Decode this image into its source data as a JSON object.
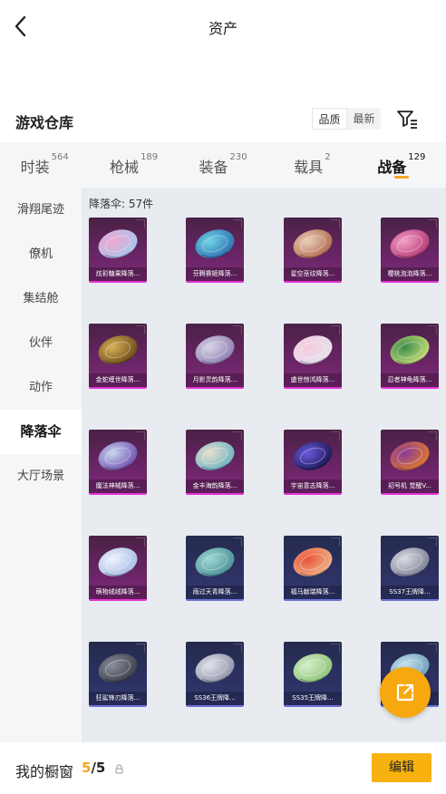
{
  "header": {
    "title": "资产"
  },
  "section": {
    "title": "游戏仓库",
    "sort": [
      "品质",
      "最新"
    ]
  },
  "tabs": [
    {
      "label": "时装",
      "count": "564"
    },
    {
      "label": "枪械",
      "count": "189"
    },
    {
      "label": "装备",
      "count": "230"
    },
    {
      "label": "载具",
      "count": "2"
    },
    {
      "label": "战备",
      "count": "129",
      "active": true
    }
  ],
  "sidebar": {
    "items": [
      "滑翔尾迹",
      "僚机",
      "集结舱",
      "伙伴",
      "动作",
      "降落伞",
      "大厅场景"
    ],
    "active_index": 5
  },
  "grid": {
    "subtitle": "降落伞: 57件",
    "items": [
      {
        "name": "炫彩糖果降落...",
        "rarity": "purple",
        "colors": [
          "#f2a6cf",
          "#a7c7f0"
        ]
      },
      {
        "name": "芬腾赛姬降落...",
        "rarity": "purple",
        "colors": [
          "#6fd3e6",
          "#2d6fb0"
        ]
      },
      {
        "name": "星空巫纹降落...",
        "rarity": "purple",
        "colors": [
          "#e9d0b8",
          "#b26a4e"
        ]
      },
      {
        "name": "樱桃泡泡降落...",
        "rarity": "purple",
        "colors": [
          "#f6a0c5",
          "#b23a76"
        ]
      },
      {
        "name": "金蛇缠世降落...",
        "rarity": "purple",
        "colors": [
          "#d8b055",
          "#6a4a1a"
        ]
      },
      {
        "name": "月影灵韵降落...",
        "rarity": "purple",
        "colors": [
          "#d9d2e6",
          "#8d7fb3"
        ]
      },
      {
        "name": "盛世惊鸿降落...",
        "rarity": "purple",
        "colors": [
          "#f5c9dc",
          "#e6e2ef"
        ]
      },
      {
        "name": "忍者神龟降落...",
        "rarity": "purple",
        "colors": [
          "#3d8a4a",
          "#c8e07a"
        ]
      },
      {
        "name": "魔法神械降落...",
        "rarity": "purple",
        "colors": [
          "#c8d6f0",
          "#6f4fae"
        ]
      },
      {
        "name": "金丰海韵降落...",
        "rarity": "purple",
        "colors": [
          "#e8e0cc",
          "#6bb3c4"
        ]
      },
      {
        "name": "宇宙意志降落...",
        "rarity": "purple",
        "colors": [
          "#6a5ae0",
          "#1a1550"
        ]
      },
      {
        "name": "初号机 觉醒V...",
        "rarity": "purple",
        "colors": [
          "#8a3a9a",
          "#e07a2a"
        ]
      },
      {
        "name": "萌物绒绒降落...",
        "rarity": "purple",
        "colors": [
          "#eef2fb",
          "#a9bde6"
        ]
      },
      {
        "name": "雨过天青降落...",
        "rarity": "blue",
        "colors": [
          "#9fd8d2",
          "#4b8f9a"
        ]
      },
      {
        "name": "福马献瑞降落...",
        "rarity": "blue",
        "colors": [
          "#e8553a",
          "#f0b48a"
        ]
      },
      {
        "name": "SS37王牌降...",
        "rarity": "blue",
        "colors": [
          "#d9dbe3",
          "#7e8194"
        ]
      },
      {
        "name": "狂鲨锋刃降落...",
        "rarity": "blue",
        "colors": [
          "#8a8e9a",
          "#3a3d48"
        ]
      },
      {
        "name": "SS36王牌降...",
        "rarity": "blue",
        "colors": [
          "#e0e2ea",
          "#8f93a8"
        ]
      },
      {
        "name": "SS35王牌降...",
        "rarity": "blue",
        "colors": [
          "#d4efc8",
          "#8fc27a"
        ]
      },
      {
        "name": "",
        "rarity": "blue",
        "colors": [
          "#c7e2ee",
          "#6d9db8"
        ]
      }
    ]
  },
  "fab": {
    "icon": "share-external-icon"
  },
  "bottombar": {
    "label": "我的橱窗",
    "count_current": "5",
    "count_sep_total": "/5",
    "edit": "编辑"
  },
  "colors": {
    "accent": "#f7b20f",
    "rarity_purple": "#e533d8",
    "rarity_blue": "#6b72d8"
  }
}
